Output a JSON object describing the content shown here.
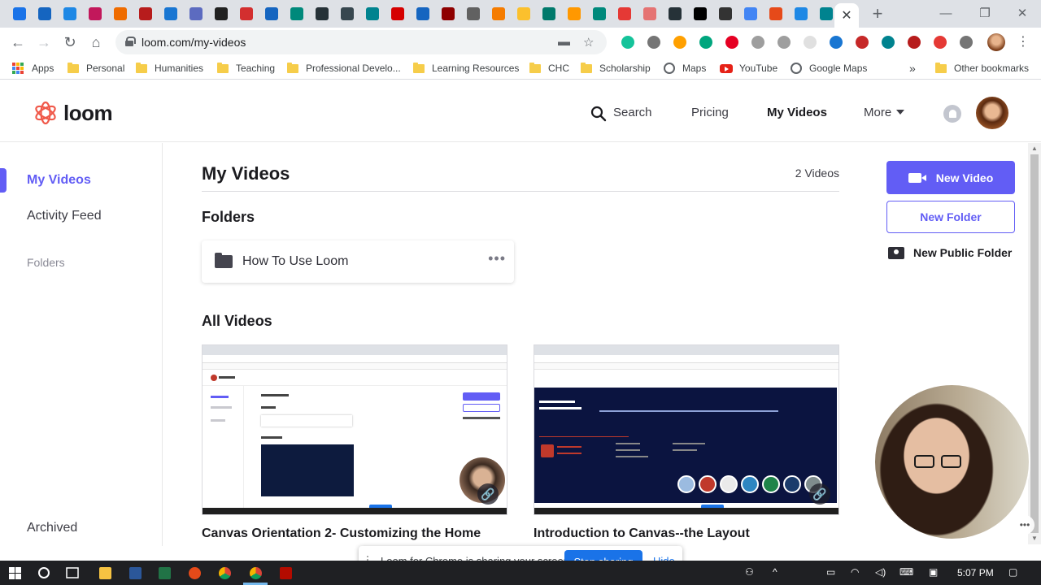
{
  "browser": {
    "url": "loom.com/my-videos",
    "close_tab_glyph": "✕",
    "new_tab_glyph": "+",
    "window_controls": [
      "—",
      "❐",
      "✕"
    ],
    "nav_glyphs": {
      "back": "←",
      "forward": "→",
      "reload": "↻",
      "home": "⌂"
    },
    "tab_icon_colors": [
      "#1a73e8",
      "#1565c0",
      "#1e88e5",
      "#c2185b",
      "#ef6c00",
      "#b71c1c",
      "#1976d2",
      "#5c6bc0",
      "#212121",
      "#d32f2f",
      "#1565c0",
      "#00897b",
      "#263238",
      "#37474f",
      "#00838f",
      "#d50000",
      "#1565c0",
      "#8e0000",
      "#616161",
      "#f57c00",
      "#fbc02d",
      "#00796b",
      "#ff9800",
      "#00897b",
      "#e53935",
      "#e57373",
      "#263238",
      "#000000",
      "#333333",
      "#4285f4",
      "#e64a19",
      "#1e88e5",
      "#00838f"
    ],
    "extension_icon_colors": [
      "#15c39a",
      "#757575",
      "#ffa000",
      "#00a67e",
      "#e60023",
      "#9e9e9e",
      "#9e9e9e",
      "#e0e0e0",
      "#1976d2",
      "#c62828",
      "#00838f",
      "#b71c1c",
      "#e53935",
      "#757575"
    ]
  },
  "bookmarks": {
    "apps": "Apps",
    "items": [
      "Personal",
      "Humanities",
      "Teaching",
      "Professional Develo...",
      "Learning Resources",
      "CHC",
      "Scholarship"
    ],
    "maps": "Maps",
    "youtube": "YouTube",
    "google_maps": "Google Maps",
    "overflow": "»",
    "other": "Other bookmarks"
  },
  "loom": {
    "brand": "loom",
    "nav": {
      "search": "Search",
      "pricing": "Pricing",
      "my_videos": "My Videos",
      "more": "More"
    },
    "accent": "#625df5"
  },
  "sidebar": {
    "items": [
      {
        "label": "My Videos",
        "active": true
      },
      {
        "label": "Activity Feed",
        "active": false
      }
    ],
    "folders_heading": "Folders",
    "archived": "Archived"
  },
  "main": {
    "title": "My Videos",
    "count": "2 Videos",
    "folders_heading": "Folders",
    "folders": [
      {
        "name": "How To Use Loom",
        "menu": "•••"
      }
    ],
    "all_videos_heading": "All Videos",
    "videos": [
      {
        "title": "Canvas Orientation 2- Customizing the Home"
      },
      {
        "title": "Introduction to Canvas--the Layout"
      }
    ]
  },
  "actions": {
    "new_video": "New Video",
    "new_folder": "New Folder",
    "new_public_folder": "New Public Folder"
  },
  "sharing_banner": {
    "text": "Loom for Chrome is sharing your screen.",
    "stop": "Stop sharing",
    "hide": "Hide"
  },
  "taskbar": {
    "time": "5:07 PM"
  }
}
